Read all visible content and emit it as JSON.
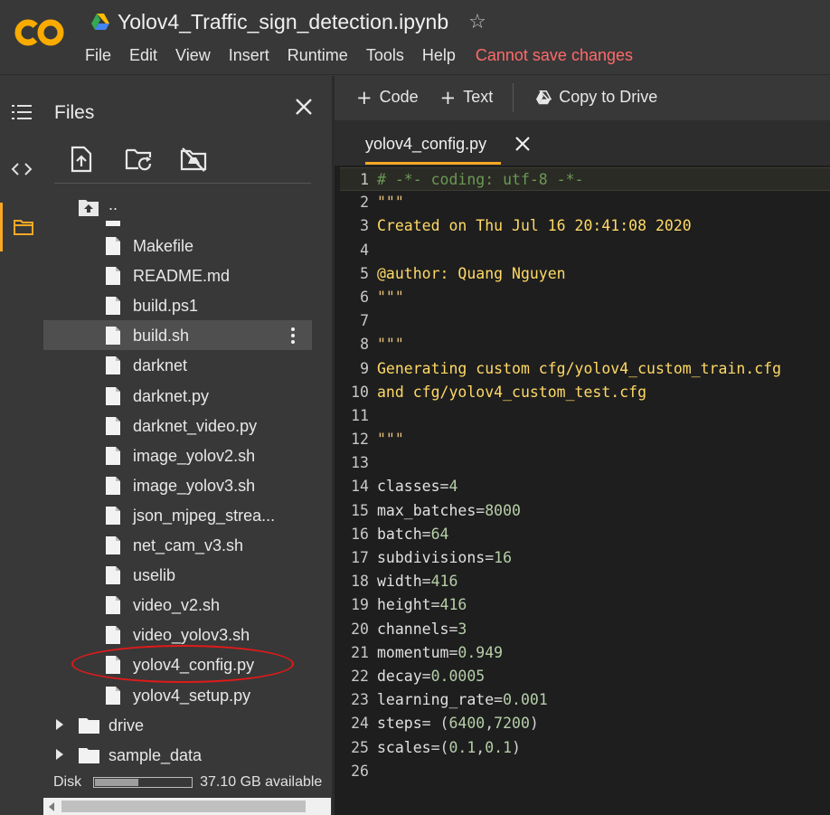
{
  "header": {
    "notebook_title": "Yolov4_Traffic_sign_detection.ipynb",
    "menu": [
      "File",
      "Edit",
      "View",
      "Insert",
      "Runtime",
      "Tools",
      "Help"
    ],
    "warning": "Cannot save changes"
  },
  "rail": {
    "icons": [
      "toc-icon",
      "code-snippets-icon",
      "files-icon"
    ]
  },
  "files_panel": {
    "title": "Files",
    "up_label": "..",
    "files": [
      {
        "name": "Makefile",
        "selected": false
      },
      {
        "name": "README.md",
        "selected": false
      },
      {
        "name": "build.ps1",
        "selected": false
      },
      {
        "name": "build.sh",
        "selected": true
      },
      {
        "name": "darknet",
        "selected": false
      },
      {
        "name": "darknet.py",
        "selected": false
      },
      {
        "name": "darknet_video.py",
        "selected": false
      },
      {
        "name": "image_yolov2.sh",
        "selected": false
      },
      {
        "name": "image_yolov3.sh",
        "selected": false
      },
      {
        "name": "json_mjpeg_strea...",
        "selected": false
      },
      {
        "name": "net_cam_v3.sh",
        "selected": false
      },
      {
        "name": "uselib",
        "selected": false
      },
      {
        "name": "video_v2.sh",
        "selected": false
      },
      {
        "name": "video_yolov3.sh",
        "selected": false
      },
      {
        "name": "yolov4_config.py",
        "selected": false,
        "highlighted": true
      },
      {
        "name": "yolov4_setup.py",
        "selected": false
      }
    ],
    "folders": [
      {
        "name": "drive"
      },
      {
        "name": "sample_data"
      }
    ],
    "disk": {
      "label": "Disk",
      "available": "37.10 GB available",
      "used_fraction": 0.45
    }
  },
  "toolbar": {
    "code_label": "Code",
    "text_label": "Text",
    "copy_label": "Copy to Drive"
  },
  "editor": {
    "tab_label": "yolov4_config.py",
    "lines": [
      {
        "n": "1",
        "parts": [
          [
            "com",
            "# -*- coding: utf-8 -*-"
          ]
        ]
      },
      {
        "n": "2",
        "parts": [
          [
            "str",
            "\"\"\""
          ]
        ]
      },
      {
        "n": "3",
        "parts": [
          [
            "str2",
            "Created on Thu Jul 16 20:41:08 2020"
          ]
        ]
      },
      {
        "n": "4",
        "parts": []
      },
      {
        "n": "5",
        "parts": [
          [
            "str2",
            "@author: Quang Nguyen"
          ]
        ]
      },
      {
        "n": "6",
        "parts": [
          [
            "str",
            "\"\"\""
          ]
        ]
      },
      {
        "n": "7",
        "parts": []
      },
      {
        "n": "8",
        "parts": [
          [
            "str",
            "\"\"\""
          ]
        ]
      },
      {
        "n": "9",
        "parts": [
          [
            "str2",
            "Generating custom cfg/yolov4_custom_train.cfg"
          ]
        ]
      },
      {
        "n": "10",
        "parts": [
          [
            "str2",
            "and cfg/yolov4_custom_test.cfg"
          ]
        ]
      },
      {
        "n": "11",
        "parts": []
      },
      {
        "n": "12",
        "parts": [
          [
            "str",
            "\"\"\""
          ]
        ]
      },
      {
        "n": "13",
        "parts": []
      },
      {
        "n": "14",
        "parts": [
          [
            "plain",
            "classes"
          ],
          [
            "op",
            "="
          ],
          [
            "num",
            "4"
          ]
        ]
      },
      {
        "n": "15",
        "parts": [
          [
            "plain",
            "max_batches"
          ],
          [
            "op",
            "="
          ],
          [
            "num",
            "8000"
          ]
        ]
      },
      {
        "n": "16",
        "parts": [
          [
            "plain",
            "batch"
          ],
          [
            "op",
            "="
          ],
          [
            "num",
            "64"
          ]
        ]
      },
      {
        "n": "17",
        "parts": [
          [
            "plain",
            "subdivisions"
          ],
          [
            "op",
            "="
          ],
          [
            "num",
            "16"
          ]
        ]
      },
      {
        "n": "18",
        "parts": [
          [
            "plain",
            "width"
          ],
          [
            "op",
            "="
          ],
          [
            "num",
            "416"
          ]
        ]
      },
      {
        "n": "19",
        "parts": [
          [
            "plain",
            "height"
          ],
          [
            "op",
            "="
          ],
          [
            "num",
            "416"
          ]
        ]
      },
      {
        "n": "20",
        "parts": [
          [
            "plain",
            "channels"
          ],
          [
            "op",
            "="
          ],
          [
            "num",
            "3"
          ]
        ]
      },
      {
        "n": "21",
        "parts": [
          [
            "plain",
            "momentum"
          ],
          [
            "op",
            "="
          ],
          [
            "num",
            "0.949"
          ]
        ]
      },
      {
        "n": "22",
        "parts": [
          [
            "plain",
            "decay"
          ],
          [
            "op",
            "="
          ],
          [
            "num",
            "0.0005"
          ]
        ]
      },
      {
        "n": "23",
        "parts": [
          [
            "plain",
            "learning_rate"
          ],
          [
            "op",
            "="
          ],
          [
            "num",
            "0.001"
          ]
        ]
      },
      {
        "n": "24",
        "parts": [
          [
            "plain",
            "steps"
          ],
          [
            "op",
            "= ("
          ],
          [
            "num",
            "6400"
          ],
          [
            "op",
            ","
          ],
          [
            "num",
            "7200"
          ],
          [
            "op",
            ")"
          ]
        ]
      },
      {
        "n": "25",
        "parts": [
          [
            "plain",
            "scales"
          ],
          [
            "op",
            "=("
          ],
          [
            "num",
            "0.1"
          ],
          [
            "op",
            ","
          ],
          [
            "num",
            "0.1"
          ],
          [
            "op",
            ")"
          ]
        ]
      },
      {
        "n": "26",
        "parts": []
      }
    ]
  },
  "colors": {
    "accent": "#f9a825",
    "warning": "#ff6a6a",
    "highlight_ellipse": "#e01a1a"
  }
}
